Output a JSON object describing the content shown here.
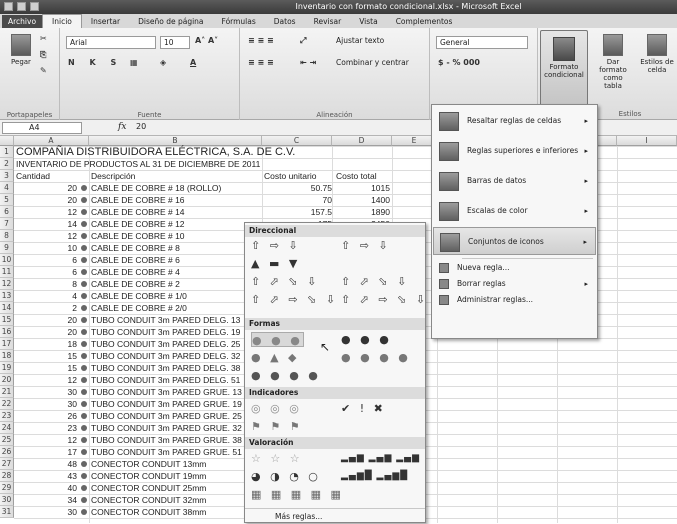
{
  "window": {
    "title": "Inventario con formato condicional.xlsx - Microsoft Excel"
  },
  "tabs": [
    "Archivo",
    "Inicio",
    "Insertar",
    "Diseño de página",
    "Fórmulas",
    "Datos",
    "Revisar",
    "Vista",
    "Complementos"
  ],
  "ribbon": {
    "paste_label": "Pegar",
    "font_name": "Arial",
    "font_size": "10",
    "font_size_buttons": "A˄ A˅",
    "bold_italic_underline": "N K S",
    "wrap_text": "Ajustar texto",
    "merge_center": "Combinar y centrar",
    "number_format": "General",
    "number_buttons": "$ - % 000",
    "cond_format": "Formato condicional",
    "format_table": "Dar formato como tabla",
    "cell_styles": "Estilos de celda",
    "groups": {
      "clipboard": "Portapapeles",
      "font": "Fuente",
      "alignment": "Alineación",
      "styles": "Estilos"
    }
  },
  "formula_bar": {
    "name_box": "A4",
    "fx": "fx",
    "value": "20"
  },
  "columns": [
    "A",
    "B",
    "C",
    "D",
    "E",
    "F",
    "G",
    "H",
    "I"
  ],
  "rows": [
    {
      "n": "1",
      "a": "COMPAÑIA DISTRIBUIDORA ELÉCTRICA, S.A. DE C.V.",
      "b": "",
      "c": "",
      "d": ""
    },
    {
      "n": "2",
      "a": "INVENTARIO DE PRODUCTOS AL 31 DE DICIEMBRE DE 2011",
      "b": "",
      "c": "",
      "d": ""
    },
    {
      "n": "3",
      "a": "Cantidad",
      "b": "Descripción",
      "c": "Costo unitario",
      "d": "Costo total"
    },
    {
      "n": "4",
      "a": "20",
      "b": "CABLE DE COBRE # 18 (ROLLO)",
      "c": "50.75",
      "d": "1015"
    },
    {
      "n": "5",
      "a": "20",
      "b": "CABLE DE COBRE # 16",
      "c": "70",
      "d": "1400"
    },
    {
      "n": "6",
      "a": "12",
      "b": "CABLE DE COBRE # 14",
      "c": "157.5",
      "d": "1890"
    },
    {
      "n": "7",
      "a": "14",
      "b": "CABLE DE COBRE # 12",
      "c": "175",
      "d": "2450"
    },
    {
      "n": "8",
      "a": "12",
      "b": "CABLE DE COBRE # 10",
      "c": "",
      "d": ""
    },
    {
      "n": "9",
      "a": "10",
      "b": "CABLE DE COBRE # 8",
      "c": "",
      "d": ""
    },
    {
      "n": "10",
      "a": "6",
      "b": "CABLE DE COBRE # 6",
      "c": "",
      "d": ""
    },
    {
      "n": "11",
      "a": "6",
      "b": "CABLE DE COBRE # 4",
      "c": "",
      "d": ""
    },
    {
      "n": "12",
      "a": "8",
      "b": "CABLE DE COBRE # 2",
      "c": "",
      "d": ""
    },
    {
      "n": "13",
      "a": "4",
      "b": "CABLE DE COBRE # 1/0",
      "c": "",
      "d": ""
    },
    {
      "n": "14",
      "a": "2",
      "b": "CABLE DE COBRE # 2/0",
      "c": "",
      "d": ""
    },
    {
      "n": "15",
      "a": "20",
      "b": "TUBO CONDUIT 3m PARED DELG. 13",
      "c": "",
      "d": ""
    },
    {
      "n": "16",
      "a": "20",
      "b": "TUBO CONDUIT 3m PARED DELG. 19",
      "c": "",
      "d": ""
    },
    {
      "n": "17",
      "a": "18",
      "b": "TUBO CONDUIT 3m PARED DELG. 25",
      "c": "",
      "d": ""
    },
    {
      "n": "18",
      "a": "15",
      "b": "TUBO CONDUIT 3m PARED DELG. 32",
      "c": "",
      "d": ""
    },
    {
      "n": "19",
      "a": "15",
      "b": "TUBO CONDUIT 3m PARED DELG. 38",
      "c": "",
      "d": ""
    },
    {
      "n": "20",
      "a": "12",
      "b": "TUBO CONDUIT 3m PARED DELG. 51",
      "c": "",
      "d": ""
    },
    {
      "n": "21",
      "a": "30",
      "b": "TUBO CONDUIT 3m PARED GRUE. 13",
      "c": "",
      "d": ""
    },
    {
      "n": "22",
      "a": "30",
      "b": "TUBO CONDUIT 3m PARED GRUE. 19",
      "c": "",
      "d": ""
    },
    {
      "n": "23",
      "a": "26",
      "b": "TUBO CONDUIT 3m PARED GRUE. 25",
      "c": "",
      "d": ""
    },
    {
      "n": "24",
      "a": "23",
      "b": "TUBO CONDUIT 3m PARED GRUE. 32",
      "c": "",
      "d": ""
    },
    {
      "n": "25",
      "a": "12",
      "b": "TUBO CONDUIT 3m PARED GRUE. 38",
      "c": "",
      "d": ""
    },
    {
      "n": "26",
      "a": "17",
      "b": "TUBO CONDUIT 3m PARED GRUE. 51",
      "c": "",
      "d": ""
    },
    {
      "n": "27",
      "a": "48",
      "b": "CONECTOR CONDUIT 13mm",
      "c": "",
      "d": ""
    },
    {
      "n": "28",
      "a": "43",
      "b": "CONECTOR CONDUIT 19mm",
      "c": "",
      "d": ""
    },
    {
      "n": "29",
      "a": "40",
      "b": "CONECTOR CONDUIT 25mm",
      "c": "",
      "d": ""
    },
    {
      "n": "30",
      "a": "34",
      "b": "CONECTOR CONDUIT 32mm",
      "c": "",
      "d": ""
    },
    {
      "n": "31",
      "a": "30",
      "b": "CONECTOR CONDUIT 38mm",
      "c": "",
      "d": ""
    }
  ],
  "cond_menu": {
    "items": [
      "Resaltar reglas de celdas",
      "Reglas superiores e inferiores",
      "Barras de datos",
      "Escalas de color",
      "Conjuntos de iconos"
    ],
    "small_items": [
      "Nueva regla...",
      "Borrar reglas",
      "Administrar reglas..."
    ]
  },
  "icon_sets": {
    "headers": [
      "Direccional",
      "Formas",
      "Indicadores",
      "Valoración"
    ],
    "more_rules": "Más reglas...",
    "directional_rows": [
      "⇧ ⇨ ⇩",
      "⇧ ⇨ ⇩",
      "▲ ▬ ▼",
      "⇧ ⬀ ⬂ ⇩",
      "⇧ ⬀ ⬂ ⇩",
      "⇧ ⬀ ⇨ ⬂ ⇩",
      "⇧ ⬀ ⇨ ⬂ ⇩"
    ],
    "shape_rows": [
      "● ● ●",
      "● ● ●",
      "● ▲ ◆",
      "● ● ● ●",
      "● ● ● ●"
    ],
    "indicator_rows": [
      "◎ ◎ ◎",
      "✔ ! ✖",
      "⚑ ⚑ ⚑"
    ],
    "rating_rows": [
      "☆ ☆ ☆",
      "▂▄▆ ▂▄▆ ▂▄▆",
      "◕ ◑ ◔ ○",
      "▂▄▆█ ▂▄▆█",
      "▦ ▦ ▦ ▦ ▦"
    ]
  }
}
